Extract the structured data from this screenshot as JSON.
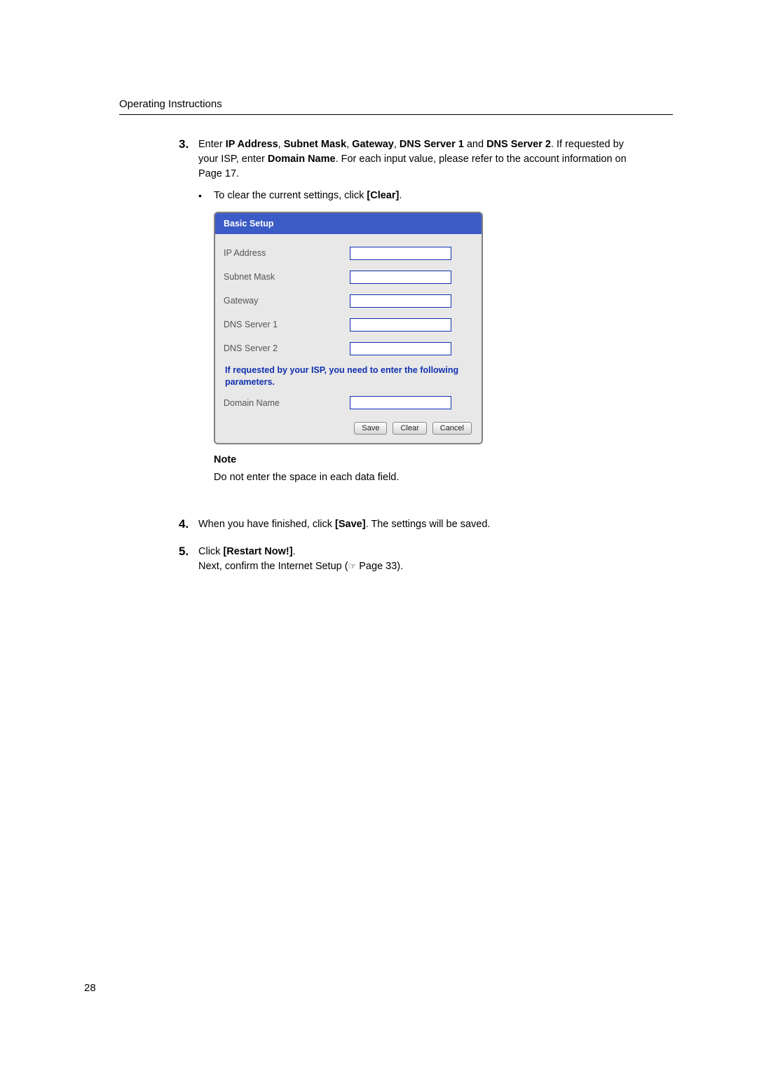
{
  "header": "Operating Instructions",
  "page_number": "28",
  "steps": {
    "s3": {
      "num": "3.",
      "t1": "Enter ",
      "b1": "IP Address",
      "t2": ", ",
      "b2": "Subnet Mask",
      "t3": ", ",
      "b3": "Gateway",
      "t4": ", ",
      "b4": "DNS Server 1",
      "t5": " and ",
      "b5": "DNS Server 2",
      "t6": ". If requested by your ISP, enter ",
      "b6": "Domain Name",
      "t7": ". For each input value, please refer to the account information on Page 17.",
      "bullet_pre": "To clear the current settings, click ",
      "bullet_bold": "[Clear]",
      "bullet_post": "."
    },
    "s4": {
      "num": "4.",
      "t1": "When you have finished, click ",
      "b1": "[Save]",
      "t2": ". The settings will be saved."
    },
    "s5": {
      "num": "5.",
      "t1": "Click ",
      "b1": "[Restart Now!]",
      "t2": ".",
      "line2_pre": "Next, confirm the Internet Setup (",
      "line2_ref": "☞",
      "line2_post": " Page 33)."
    }
  },
  "panel": {
    "title": "Basic Setup",
    "labels": {
      "ip": "IP Address",
      "mask": "Subnet Mask",
      "gateway": "Gateway",
      "dns1": "DNS Server 1",
      "dns2": "DNS Server 2",
      "domain": "Domain Name"
    },
    "message": "If requested by your ISP, you need to enter the following parameters.",
    "buttons": {
      "save": "Save",
      "clear": "Clear",
      "cancel": "Cancel"
    }
  },
  "note": {
    "heading": "Note",
    "text": "Do not enter the space in each data field."
  }
}
